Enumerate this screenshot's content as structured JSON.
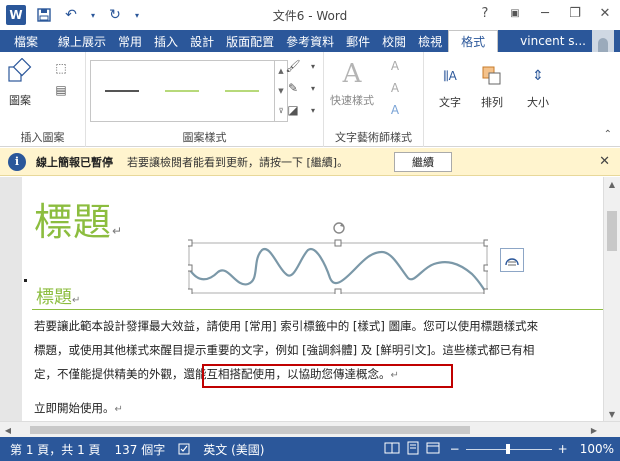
{
  "window": {
    "title": "文件6 - Word",
    "help": "?",
    "minimize": "─",
    "restore": "❐",
    "close": "✕"
  },
  "quick_access": {
    "logo": "W",
    "save_icon": "save-icon",
    "undo_icon": "undo-icon",
    "redo_icon": "redo-icon"
  },
  "tabs": [
    {
      "label": "檔案"
    },
    {
      "label": "線上展示"
    },
    {
      "label": "常用"
    },
    {
      "label": "插入"
    },
    {
      "label": "設計"
    },
    {
      "label": "版面配置"
    },
    {
      "label": "參考資料"
    },
    {
      "label": "郵件"
    },
    {
      "label": "校閱"
    },
    {
      "label": "檢視"
    },
    {
      "label": "格式"
    }
  ],
  "user": {
    "name": "vincent s..."
  },
  "ribbon": {
    "groups": {
      "insert_shapes": "插入圖案",
      "shape_styles": "圖案樣式",
      "wordart_styles": "文字藝術師樣式"
    },
    "buttons": {
      "shapes": "圖案",
      "quick_styles": "快速樣式",
      "text": "文字",
      "arrange": "排列",
      "size": "大小"
    },
    "gallery_colors": [
      "#555555",
      "#b7d97a",
      "#b7d97a"
    ]
  },
  "message_bar": {
    "title": "線上簡報已暫停",
    "text": "若要讓檢閱者能看到更新，請按一下 [繼續]。",
    "button": "繼續"
  },
  "document": {
    "title": "標題",
    "heading": "標題",
    "paragraph_lines": [
      "若要讓此範本設計發揮最大效益，請使用 [常用] 索引標籤中的 [樣式] 圖庫。您可以使用標題樣式來",
      "標題，或使用其他樣式來醒目提示重要的文字，例如 [強調斜體] 及 [鮮明引文]。這些樣式都已有相",
      "定，不僅能提供精美的外觀，還能互相搭配使用，以協助您傳達概念。"
    ],
    "paragraph2": "立即開始使用。",
    "paragraph_mark": "↵",
    "accent_color": "#8cbd3f"
  },
  "status": {
    "page": "第 1 頁，共 1 頁",
    "words": "137 個字",
    "language": "英文 (美國)",
    "zoom_minus": "−",
    "zoom_plus": "+",
    "zoom": "100%"
  }
}
